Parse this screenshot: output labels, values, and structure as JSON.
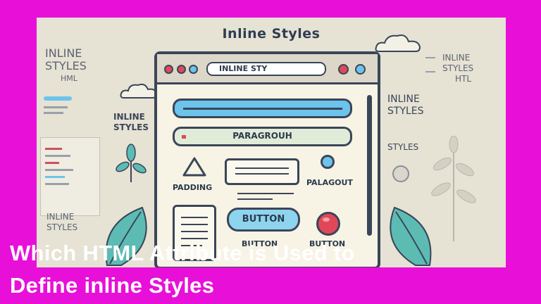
{
  "poster": {
    "heading": "Inline Styles",
    "left_top_label_1": "INLINE",
    "left_top_label_2": "STYLES",
    "left_top_label_3": "HML",
    "left_mid_label_1": "INLINE",
    "left_mid_label_2": "STYLES",
    "left_bottom_label_1": "INLINE",
    "left_bottom_label_2": "STYLES",
    "right_top_label_1": "INLINE",
    "right_top_label_2": "STYLES",
    "right_top_label_3": "HTL",
    "right_mid_label_1": "INLINE",
    "right_mid_label_2": "STYLES",
    "right_low_label": "STYLES"
  },
  "window": {
    "url_text": "INLINE STY",
    "paragraph_label": "PARAGROUH",
    "padding_label": "PADDING",
    "palagout_label": "PALAGOUT",
    "button_primary_label": "BUTTON",
    "button_under_label": "BUTTON",
    "button_red_label": "BUTTON"
  },
  "overlay": {
    "title_line_1": "Which HTML Attribute is Used to",
    "title_line_2": "Define inline Styles"
  },
  "colors": {
    "frame": "#e810d8",
    "poster_bg": "#e6e2d4",
    "accent_blue": "#6cc4ec",
    "accent_red": "#e0485a",
    "leaf_teal": "#5cbcb4"
  }
}
